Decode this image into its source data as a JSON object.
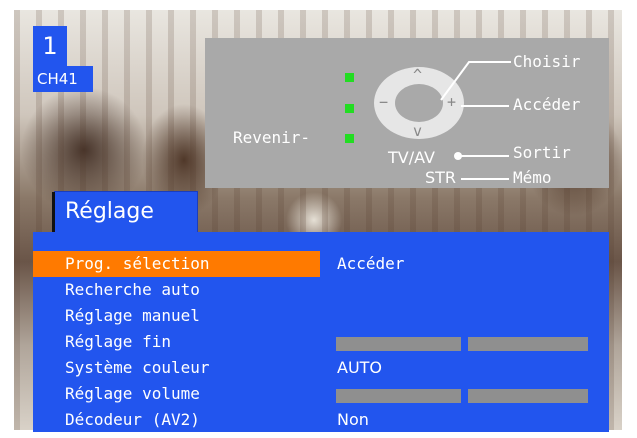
{
  "channel": {
    "number": "1",
    "name": "CH41"
  },
  "remote_help": {
    "choisir": "Choisir",
    "acceder": "Accéder",
    "revenir": "Revenir-",
    "tvav": "TV/AV",
    "sortir": "Sortir",
    "str": "STR",
    "memo": "Mémo",
    "up_symbol": "^",
    "down_symbol": "v",
    "minus_symbol": "−",
    "plus_symbol": "+"
  },
  "menu": {
    "title": "Réglage",
    "items": [
      {
        "label": "Prog. sélection",
        "value": "Accéder",
        "selected": true
      },
      {
        "label": "Recherche auto",
        "value": ""
      },
      {
        "label": "Réglage manuel",
        "value": ""
      },
      {
        "label": "Réglage fin",
        "value": ""
      },
      {
        "label": "Système couleur",
        "value": "AUTO"
      },
      {
        "label": "Réglage volume",
        "value": ""
      },
      {
        "label": "Décodeur (AV2)",
        "value": "Non"
      }
    ]
  },
  "colors": {
    "menu_bg": "#2255ee",
    "highlight": "#ff7a00",
    "led": "#22dd22",
    "panel": "#a9a9a9"
  }
}
